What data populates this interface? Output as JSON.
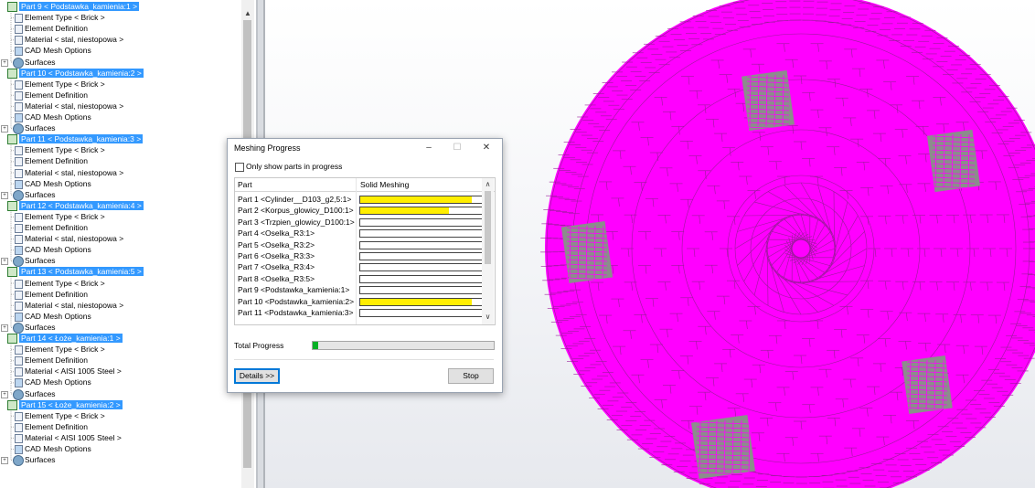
{
  "tree": {
    "parts": [
      {
        "label": "Part 9 < Podstawka_kamienia:1 >",
        "element_type": "Element Type < Brick >",
        "element_def": "Element Definition",
        "material": "Material < stal, niestopowa >",
        "cad_mesh": "CAD Mesh Options",
        "surfaces": "Surfaces"
      },
      {
        "label": "Part 10 < Podstawka_kamienia:2 >",
        "element_type": "Element Type < Brick >",
        "element_def": "Element Definition",
        "material": "Material < stal, niestopowa >",
        "cad_mesh": "CAD Mesh Options",
        "surfaces": "Surfaces"
      },
      {
        "label": "Part 11 < Podstawka_kamienia:3 >",
        "element_type": "Element Type < Brick >",
        "element_def": "Element Definition",
        "material": "Material < stal, niestopowa >",
        "cad_mesh": "CAD Mesh Options",
        "surfaces": "Surfaces"
      },
      {
        "label": "Part 12 < Podstawka_kamienia:4 >",
        "element_type": "Element Type < Brick >",
        "element_def": "Element Definition",
        "material": "Material < stal, niestopowa >",
        "cad_mesh": "CAD Mesh Options",
        "surfaces": "Surfaces"
      },
      {
        "label": "Part 13 < Podstawka_kamienia:5 >",
        "element_type": "Element Type < Brick >",
        "element_def": "Element Definition",
        "material": "Material < stal, niestopowa >",
        "cad_mesh": "CAD Mesh Options",
        "surfaces": "Surfaces"
      },
      {
        "label": "Part 14 < Łoże_kamienia:1 >",
        "element_type": "Element Type < Brick >",
        "element_def": "Element Definition",
        "material": "Material < AISI 1005 Steel >",
        "cad_mesh": "CAD Mesh Options",
        "surfaces": "Surfaces"
      },
      {
        "label": "Part 15 < Łoże_kamienia:2 >",
        "element_type": "Element Type < Brick >",
        "element_def": "Element Definition",
        "material": "Material < AISI 1005 Steel >",
        "cad_mesh": "CAD Mesh Options",
        "surfaces": "Surfaces"
      }
    ]
  },
  "dialog": {
    "title": "Meshing Progress",
    "minimize": "–",
    "maximize": "☐",
    "close": "✕",
    "checkbox_label": "Only show parts in progress",
    "col_part": "Part",
    "col_status": "Solid Meshing",
    "rows": [
      {
        "name": "Part 1 <Cylinder__D103_g2,5:1>",
        "progress": 0.9
      },
      {
        "name": "Part 2 <Korpus_glowicy_D100:1>",
        "progress": 0.72
      },
      {
        "name": "Part 3 <Trzpien_glowicy_D100:1>",
        "progress": 0
      },
      {
        "name": "Part 4 <Oselka_R3:1>",
        "progress": 0
      },
      {
        "name": "Part 5 <Oselka_R3:2>",
        "progress": 0
      },
      {
        "name": "Part 6 <Oselka_R3:3>",
        "progress": 0
      },
      {
        "name": "Part 7 <Oselka_R3:4>",
        "progress": 0
      },
      {
        "name": "Part 8 <Oselka_R3:5>",
        "progress": 0
      },
      {
        "name": "Part 9 <Podstawka_kamienia:1>",
        "progress": 0
      },
      {
        "name": "Part 10 <Podstawka_kamienia:2>",
        "progress": 0.9
      },
      {
        "name": "Part 11 <Podstawka_kamienia:3>",
        "progress": 0
      }
    ],
    "total_label": "Total Progress",
    "total_progress": 0.03,
    "details_label": "Details >>",
    "stop_label": "Stop"
  },
  "colors": {
    "selection": "#3399ff",
    "mesh": "#ff00ff",
    "pads": "#8c8c8c",
    "progress_yellow": "#ffee00",
    "progress_green": "#06b025"
  }
}
